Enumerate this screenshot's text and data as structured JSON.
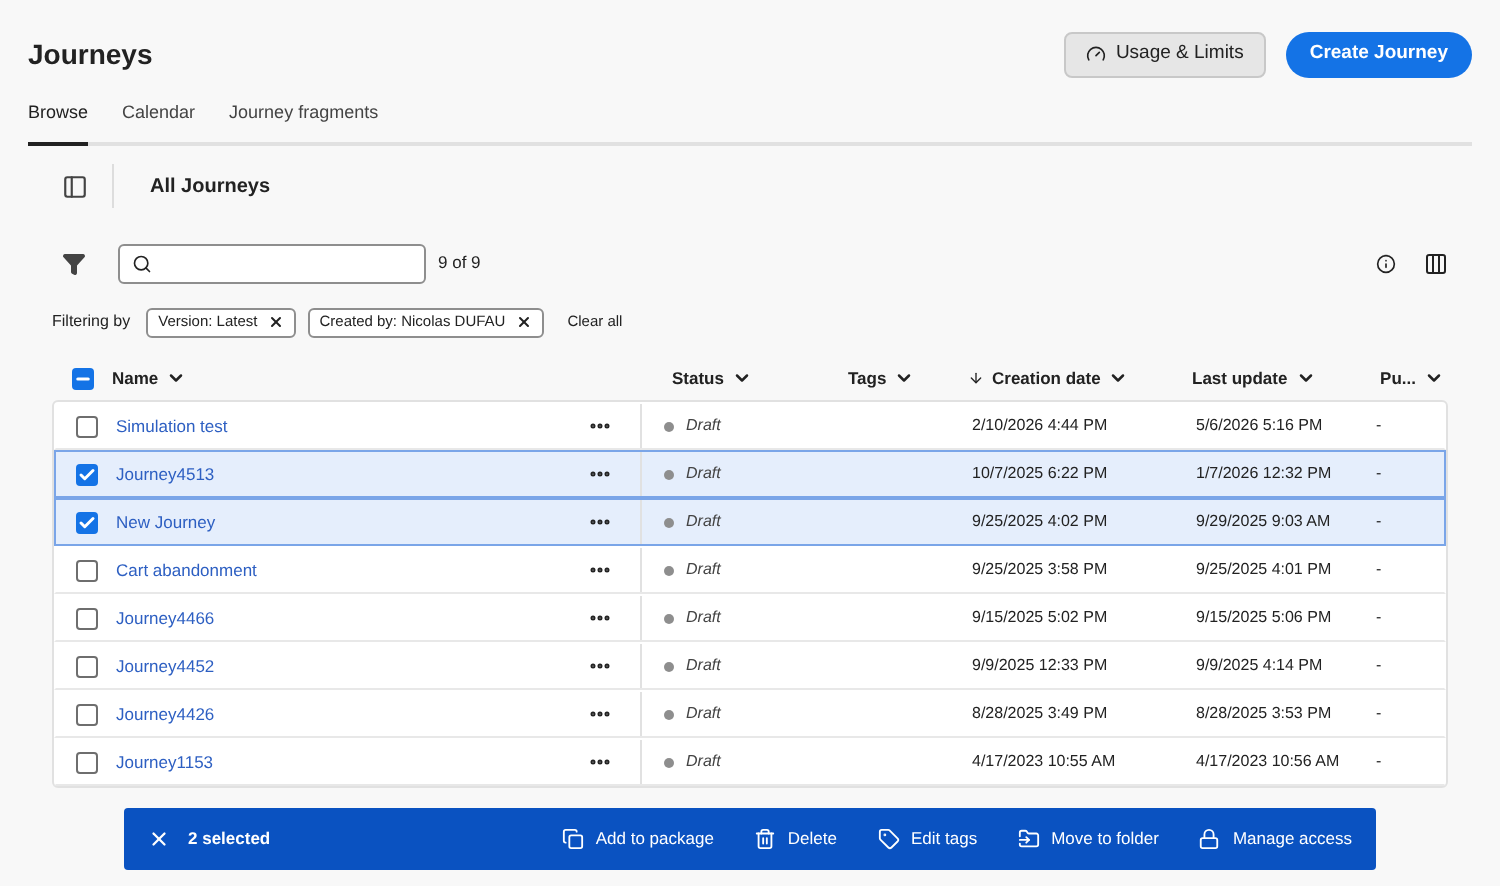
{
  "page": {
    "title": "Journeys"
  },
  "header_buttons": [
    {
      "label": "Usage & Limits",
      "kind": "secondary"
    },
    {
      "label": "Create Journey",
      "kind": "primary"
    }
  ],
  "tabs": [
    {
      "label": "Browse",
      "selected": true
    },
    {
      "label": "Calendar",
      "selected": false
    },
    {
      "label": "Journey fragments",
      "selected": false
    }
  ],
  "view": {
    "title": "All Journeys"
  },
  "search": {
    "count": "9 of 9"
  },
  "filters": {
    "label": "Filtering by",
    "tags": [
      "Version: Latest",
      "Created by: Nicolas DUFAU"
    ],
    "clear": "Clear all"
  },
  "table": {
    "select_all": {
      "checked": true,
      "indeterminate": true
    },
    "columns": [
      {
        "label": "Name",
        "sorted": false
      },
      {
        "label": "Status",
        "sorted": false
      },
      {
        "label": "Tags",
        "sorted": false
      },
      {
        "label": "Creation date",
        "sorted": true
      },
      {
        "label": "Last update",
        "sorted": false
      },
      {
        "label": "Pu...",
        "sorted": false
      }
    ],
    "rows": [
      {
        "name": "Simulation test",
        "status": "Draft",
        "created": "2/10/2026 4:44 PM",
        "updated": "5/6/2026 5:16 PM",
        "published": "-",
        "selected": false
      },
      {
        "name": "Journey4513",
        "status": "Draft",
        "created": "10/7/2025 6:22 PM",
        "updated": "1/7/2026 12:32 PM",
        "published": "-",
        "selected": true
      },
      {
        "name": "New Journey",
        "status": "Draft",
        "created": "9/25/2025 4:02 PM",
        "updated": "9/29/2025 9:03 AM",
        "published": "-",
        "selected": true
      },
      {
        "name": "Cart abandonment",
        "status": "Draft",
        "created": "9/25/2025 3:58 PM",
        "updated": "9/25/2025 4:01 PM",
        "published": "-",
        "selected": false
      },
      {
        "name": "Journey4466",
        "status": "Draft",
        "created": "9/15/2025 5:02 PM",
        "updated": "9/15/2025 5:06 PM",
        "published": "-",
        "selected": false
      },
      {
        "name": "Journey4452",
        "status": "Draft",
        "created": "9/9/2025 12:33 PM",
        "updated": "9/9/2025 4:14 PM",
        "published": "-",
        "selected": false
      },
      {
        "name": "Journey4426",
        "status": "Draft",
        "created": "8/28/2025 3:49 PM",
        "updated": "8/28/2025 3:53 PM",
        "published": "-",
        "selected": false
      },
      {
        "name": "Journey1153",
        "status": "Draft",
        "created": "4/17/2023 10:55 AM",
        "updated": "4/17/2023 10:56 AM",
        "published": "-",
        "selected": false
      }
    ]
  },
  "action_bar": {
    "count": "2 selected",
    "actions": [
      {
        "label": "Add to package",
        "kind": "package"
      },
      {
        "label": "Delete",
        "kind": "delete"
      },
      {
        "label": "Edit tags",
        "kind": "tag"
      },
      {
        "label": "Move to folder",
        "kind": "folder"
      },
      {
        "label": "Manage access",
        "kind": "lock"
      }
    ]
  }
}
